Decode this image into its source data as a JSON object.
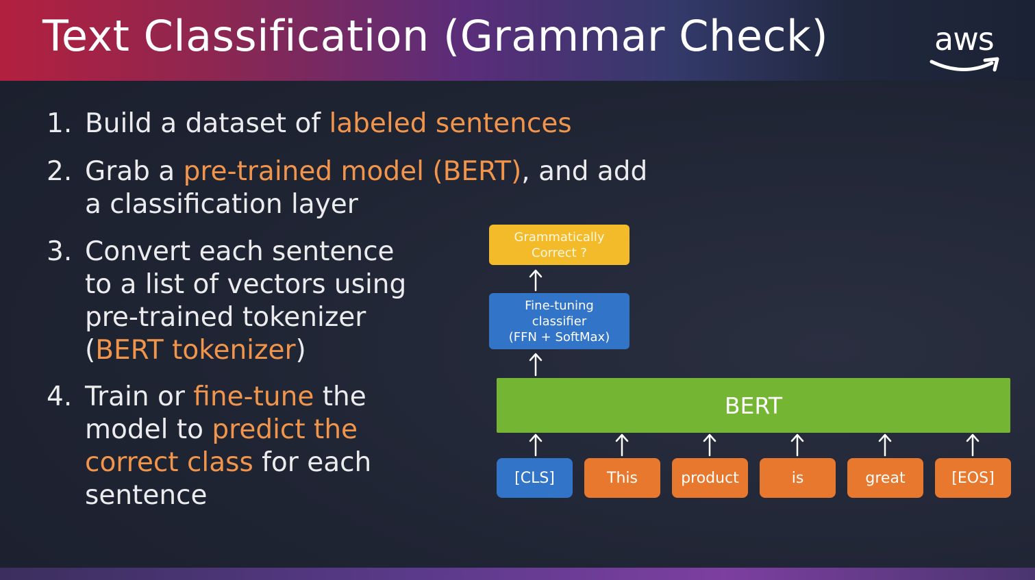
{
  "slide": {
    "title": "Text Classification (Grammar Check)",
    "logo_text": "aws",
    "logo_icon": "aws-smile-arrow-icon"
  },
  "steps": [
    {
      "number": "1.",
      "lines": [
        [
          {
            "text": "Build a dataset of "
          },
          {
            "text": "labeled sentences",
            "hl": true
          }
        ]
      ]
    },
    {
      "number": "2.",
      "lines": [
        [
          {
            "text": "Grab a "
          },
          {
            "text": "pre-trained model (BERT)",
            "hl": true
          },
          {
            "text": ", and add"
          }
        ],
        [
          {
            "text": "a classification layer"
          }
        ]
      ]
    },
    {
      "number": "3.",
      "lines": [
        [
          {
            "text": "Convert each sentence"
          }
        ],
        [
          {
            "text": "to a list of vectors using"
          }
        ],
        [
          {
            "text": "pre-trained tokenizer"
          }
        ],
        [
          {
            "text": "("
          },
          {
            "text": "BERT tokenizer",
            "hl": true
          },
          {
            "text": ")"
          }
        ]
      ]
    },
    {
      "number": "4.",
      "lines": [
        [
          {
            "text": "Train or "
          },
          {
            "text": "fine-tune",
            "hl": true
          },
          {
            "text": " the"
          }
        ],
        [
          {
            "text": "model to "
          },
          {
            "text": "predict the",
            "hl": true
          }
        ],
        [
          {
            "text": "correct class",
            "hl": true
          },
          {
            "text": " for each"
          }
        ],
        [
          {
            "text": "sentence"
          }
        ]
      ]
    }
  ],
  "diagram": {
    "output_line1": "Grammatically",
    "output_line2": "Correct ?",
    "classifier_line1": "Fine-tuning",
    "classifier_line2": "classifier",
    "classifier_line3": "(FFN + SoftMax)",
    "model": "BERT",
    "tokens": [
      {
        "label": "[CLS]",
        "color": "blue"
      },
      {
        "label": "This",
        "color": "orange"
      },
      {
        "label": "product",
        "color": "orange"
      },
      {
        "label": "is",
        "color": "orange"
      },
      {
        "label": "great",
        "color": "orange"
      },
      {
        "label": "[EOS]",
        "color": "orange"
      }
    ]
  },
  "colors": {
    "highlight": "#f0954b",
    "output_box": "#f3bb2a",
    "classifier_box": "#3274c8",
    "bert_box": "#74b634",
    "token_blue": "#3274c8",
    "token_orange": "#e9782f"
  }
}
